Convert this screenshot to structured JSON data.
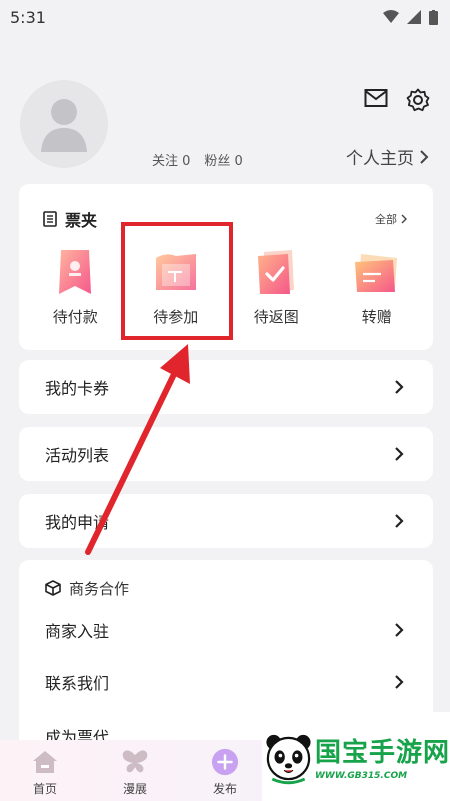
{
  "status_bar": {
    "time": "5:31"
  },
  "profile": {
    "follow_label": "关注 0",
    "fans_label": "粉丝 0",
    "homepage_label": "个人主页"
  },
  "tickets": {
    "title": "票夹",
    "all_label": "全部",
    "items": [
      {
        "label": "待付款",
        "icon": "pending-payment-icon"
      },
      {
        "label": "待参加",
        "icon": "pending-attend-icon"
      },
      {
        "label": "待返图",
        "icon": "pending-photo-icon"
      },
      {
        "label": "转赠",
        "icon": "transfer-icon"
      }
    ]
  },
  "menu": {
    "coupons": "我的卡券",
    "activities": "活动列表",
    "applications": "我的申请"
  },
  "business": {
    "title": "商务合作",
    "merchant_join": "商家入驻",
    "contact_us": "联系我们",
    "partial_item": "成为票代"
  },
  "tabs": [
    {
      "label": "首页",
      "icon": "home-icon"
    },
    {
      "label": "漫展",
      "icon": "butterfly-icon"
    },
    {
      "label": "发布",
      "icon": "plus-icon"
    }
  ],
  "watermark": {
    "text": "国宝手游网",
    "url": "WWW.GB315.COM"
  },
  "colors": {
    "accent": "#f46a8a",
    "annotation": "#e0262c",
    "watermark": "#17a34a"
  }
}
